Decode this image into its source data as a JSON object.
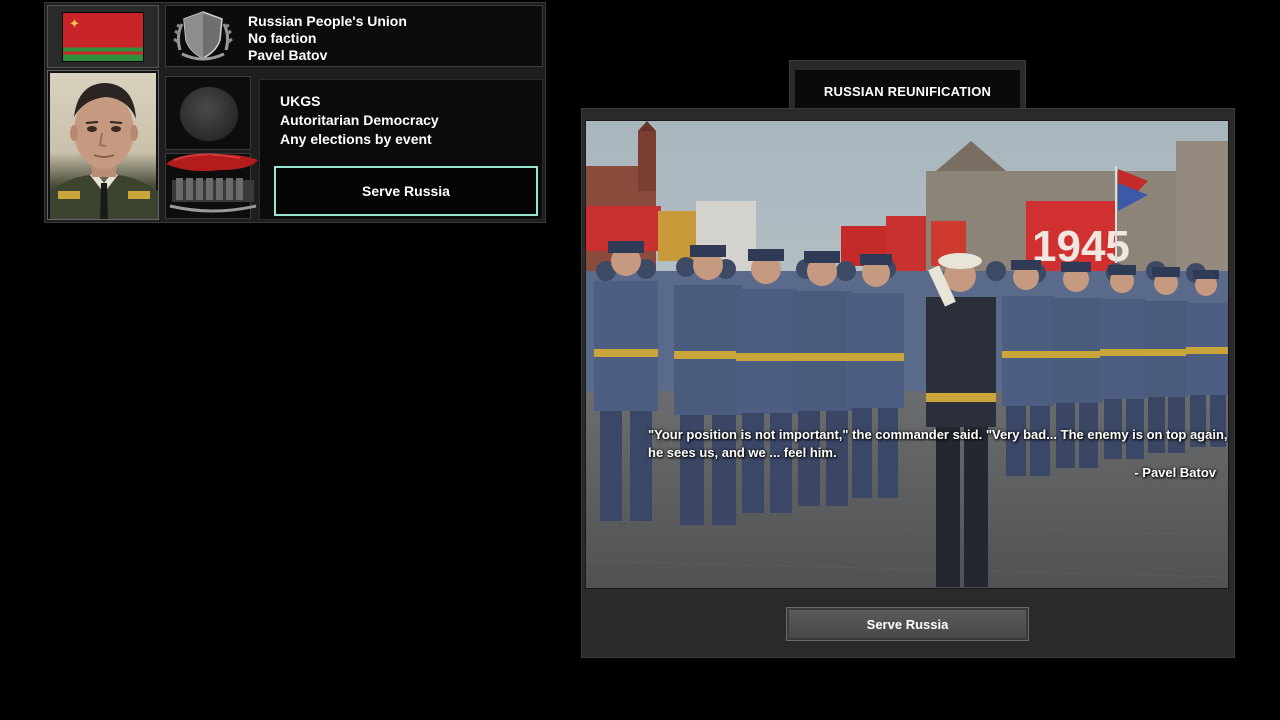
{
  "country": {
    "name": "Russian People's Union",
    "faction": "No faction",
    "leader": "Pavel Batov",
    "party": "UKGS",
    "ideology": "Autoritarian Democracy",
    "elections": "Any elections by event",
    "decision_button_label": "Serve Russia",
    "flag_colors": {
      "red": "#c8242a",
      "green": "#2f8f3a",
      "emblem": "#f2c94c"
    },
    "icons": {
      "flag": "flag-icon",
      "faction_emblem": "shield-laurel-icon",
      "ideology": "ideology-circle-icon",
      "party": "party-soldiers-icon"
    }
  },
  "event": {
    "title": "RUSSIAN REUNIFICATION",
    "quote": "\"Your position is not important,\" the commander said. \"Very bad... The enemy is on top again, he sees us, and we ... feel him.",
    "quote_author": "- Pavel Batov",
    "option_label": "Serve Russia",
    "banner_text": "1945"
  },
  "colors": {
    "panel": "#1e1e1e",
    "accent_border": "#9be4d4",
    "window": "#2a2a2a",
    "button": "#4f4f4f"
  }
}
